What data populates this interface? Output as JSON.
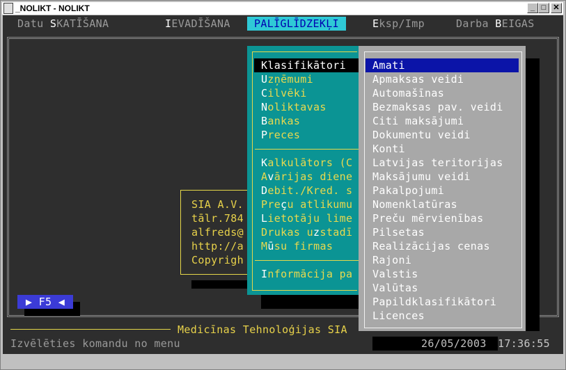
{
  "window": {
    "title": "_NOLIKT - NOLIKT",
    "min_glyph": "_",
    "max_glyph": "□",
    "close_glyph": "✕"
  },
  "menubar": {
    "items": [
      {
        "hk": "",
        "pre": "Datu ",
        "hot": "S",
        "post": "KATĪŠANA"
      },
      {
        "pre": "",
        "hot": "I",
        "post": "EVADĪŠANA"
      },
      {
        "pre": "",
        "hot": "PAL",
        "post": "ĪGLĪDZEKĻI"
      },
      {
        "pre": "",
        "hot": "E",
        "post": "ksp/Imp"
      },
      {
        "pre": "Darba ",
        "hot": "B",
        "post": "EIGAS"
      }
    ]
  },
  "palidzekli_menu": {
    "items": [
      {
        "hot": "K",
        "rest": "lasifikātori"
      },
      {
        "hot": "U",
        "rest": "zņēmumi"
      },
      {
        "hot": "C",
        "rest": "ilvēki"
      },
      {
        "hot": "N",
        "rest": "oliktavas"
      },
      {
        "hot": "B",
        "rest": "ankas"
      },
      {
        "hot": "P",
        "rest": "reces"
      },
      {
        "hot": "K",
        "rest": "alkulātors (C"
      },
      {
        "pre": "A",
        "hot": "v",
        "rest": "ārijas diene"
      },
      {
        "hot": "D",
        "rest": "ebit./Kred. s"
      },
      {
        "pre": "Pre",
        "hot": "ç",
        "rest": "u atlikumu"
      },
      {
        "hot": "L",
        "rest": "ietotāju lime"
      },
      {
        "pre": "Drukas u",
        "hot": "z",
        "rest": "stadī"
      },
      {
        "pre": "M",
        "hot": "ū",
        "rest": "su firmas"
      },
      {
        "hot": "I",
        "rest": "nformācija pa"
      }
    ]
  },
  "klasifikatori_menu": {
    "items": [
      "Amati",
      "Apmaksas veidi",
      "Automašīnas",
      "Bezmaksas pav. veidi",
      "Citi maksājumi",
      "Dokumentu veidi",
      "Konti",
      "Latvijas teritorijas",
      "Maksājumu veidi",
      "Pakalpojumi",
      "Nomenklatūras",
      "Preču mērvienības",
      "Pilsetas",
      "Realizācijas cenas",
      "Rajoni",
      "Valstis",
      "Valūtas",
      "Papildklasifikātori",
      "Licences"
    ],
    "selected": "Amati"
  },
  "info_box": {
    "lines": [
      "SIA A.V.",
      "tālr.784",
      "alfreds@",
      "http://a",
      "Copyrigh"
    ]
  },
  "f5_label": "▶ F5 ◀",
  "footer": {
    "banner": "Medicīnas Tehnoloģijas SIA",
    "status": "Izvēlēties komandu no menu",
    "date": "26/05/2003",
    "time": "17:36:55"
  },
  "colors": {
    "accent_teal": "#0b9494",
    "menu_highlight": "#2fc9d6",
    "selection_blue": "#0b14a8",
    "text_yellow": "#e8d24a"
  }
}
